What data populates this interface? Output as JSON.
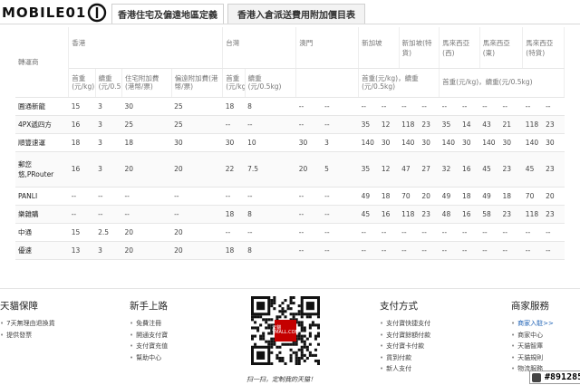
{
  "header": {
    "logo_text": "MOBILE01",
    "tabs": [
      {
        "label": "香港住宅及偏遠地區定義"
      },
      {
        "label": "香港入倉派送費用附加價目表"
      }
    ]
  },
  "table": {
    "first_col_header": "轉運商",
    "regions": [
      "香港",
      "台灣",
      "澳門",
      "新加坡",
      "新加坡(特貨)",
      "馬來西亞(西)",
      "馬來西亞(東)",
      "馬來西亞(特貨)"
    ],
    "subheaders": {
      "hk_first": "首重(元/kg)",
      "hk_cont": "續重(元/0.5kg)",
      "hk_res": "住宅附加費(港幣/票)",
      "hk_remote": "偏遠附加費(港幣/票)",
      "tw_first": "首重(元/kg)",
      "tw_cont": "續重(元/0.5kg)",
      "sg": "首重(元/kg)，續重(元/0.5kg)",
      "my": "首重(元/kg)，續重(元/0.5kg)"
    },
    "rows": [
      {
        "name": "圓通新龍",
        "cells": [
          "15",
          "3",
          "30",
          "25",
          "18",
          "8",
          "--",
          "--",
          "--",
          "--",
          "--",
          "--",
          "--",
          "--",
          "--",
          "--",
          "--",
          "--"
        ]
      },
      {
        "name": "4PX遞四方",
        "cells": [
          "16",
          "3",
          "25",
          "25",
          "--",
          "--",
          "--",
          "--",
          "35",
          "12",
          "118",
          "23",
          "35",
          "14",
          "43",
          "21",
          "118",
          "23"
        ]
      },
      {
        "name": "順豐速運",
        "cells": [
          "18",
          "3",
          "18",
          "30",
          "30",
          "10",
          "30",
          "3",
          "140",
          "30",
          "140",
          "30",
          "140",
          "30",
          "140",
          "30",
          "140",
          "30"
        ]
      },
      {
        "name": "郵您悠,PRouter",
        "cells": [
          "16",
          "3",
          "20",
          "20",
          "22",
          "7.5",
          "20",
          "5",
          "35",
          "12",
          "47",
          "27",
          "32",
          "16",
          "45",
          "23",
          "45",
          "23"
        ]
      },
      {
        "name": "PANLI",
        "cells": [
          "--",
          "--",
          "--",
          "--",
          "--",
          "--",
          "--",
          "--",
          "49",
          "18",
          "70",
          "20",
          "49",
          "18",
          "49",
          "18",
          "70",
          "20"
        ]
      },
      {
        "name": "樂雜購",
        "cells": [
          "--",
          "--",
          "--",
          "--",
          "18",
          "8",
          "--",
          "--",
          "45",
          "16",
          "118",
          "23",
          "48",
          "16",
          "58",
          "23",
          "118",
          "23"
        ]
      },
      {
        "name": "中通",
        "cells": [
          "15",
          "2.5",
          "20",
          "20",
          "--",
          "--",
          "--",
          "--",
          "--",
          "--",
          "--",
          "--",
          "--",
          "--",
          "--",
          "--",
          "--",
          "--"
        ]
      },
      {
        "name": "優速",
        "cells": [
          "13",
          "3",
          "20",
          "20",
          "18",
          "8",
          "--",
          "--",
          "--",
          "--",
          "--",
          "--",
          "--",
          "--",
          "--",
          "--",
          "--",
          "--"
        ]
      }
    ]
  },
  "footer": {
    "col1": {
      "title": "天貓保障",
      "items": [
        "7天無理由退換貨",
        "提供發票"
      ]
    },
    "col2": {
      "title": "新手上路",
      "items": [
        "免費注冊",
        "開通支付寶",
        "支付寶充值",
        "幫助中心"
      ]
    },
    "qr_badge": "天貓 TMALL.COM",
    "qr_caption": "扫一扫，定制我的天猫！",
    "col3": {
      "title": "支付方式",
      "items": [
        "支付寶快捷支付",
        "支付寶餘額付款",
        "支付寶卡付款",
        "貨到付款",
        "新人支付"
      ]
    },
    "col4": {
      "title": "商家服務",
      "items": [
        "商家入駐>>",
        "商家中心",
        "天貓智庫",
        "天貓規則",
        "物流服務"
      ]
    }
  },
  "watermark": "#891285",
  "colors": {
    "link": "#1a5fb4",
    "brand_red": "#c40000"
  }
}
